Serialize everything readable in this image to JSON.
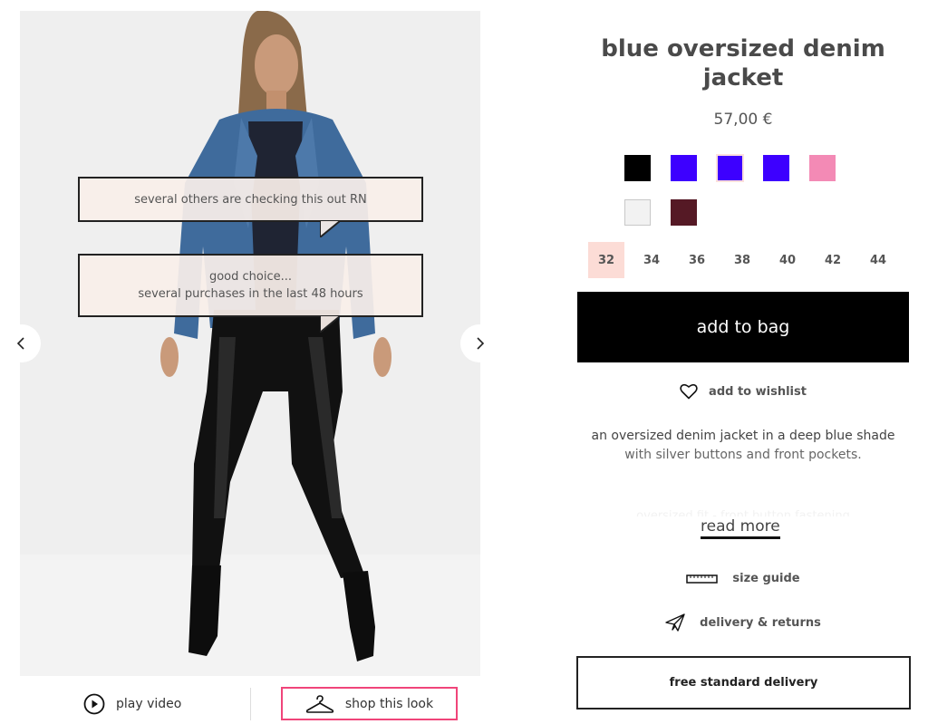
{
  "gallery": {
    "bubbles": [
      {
        "lines": [
          "several others are checking this out RN"
        ]
      },
      {
        "lines": [
          "good choice...",
          "several purchases in the last 48 hours"
        ]
      }
    ],
    "prev_icon": "chevron-left-icon",
    "next_icon": "chevron-right-icon"
  },
  "media": {
    "play_video_label": "play video",
    "shop_look_label": "shop this look",
    "shop_look_border_color": "#f0457a"
  },
  "product": {
    "title": "blue oversized denim jacket",
    "price": "57,00 €",
    "colors": [
      {
        "name": "black",
        "hex": "#000000",
        "selected": false
      },
      {
        "name": "blue",
        "hex": "#3d00ff",
        "selected": false
      },
      {
        "name": "blue",
        "hex": "#3d00ff",
        "selected": true
      },
      {
        "name": "blue",
        "hex": "#3d00ff",
        "selected": false
      },
      {
        "name": "pink",
        "hex": "#f38ab5",
        "selected": false
      },
      {
        "name": "white",
        "hex": "#f2f2f2",
        "selected": false
      },
      {
        "name": "burgundy",
        "hex": "#551925",
        "selected": false
      }
    ],
    "sizes": [
      {
        "label": "32",
        "selected": true
      },
      {
        "label": "34",
        "selected": false
      },
      {
        "label": "36",
        "selected": false
      },
      {
        "label": "38",
        "selected": false
      },
      {
        "label": "40",
        "selected": false
      },
      {
        "label": "42",
        "selected": false
      },
      {
        "label": "44",
        "selected": false
      }
    ],
    "add_to_bag_label": "add to bag",
    "wishlist_label": "add to wishlist",
    "description": {
      "line1": "an oversized denim jacket in a deep blue shade",
      "line2": "with silver buttons and front pockets.",
      "faded_line": "oversized fit - front button fastening"
    },
    "read_more_label": "read more",
    "size_guide_label": "size guide",
    "delivery_label": "delivery & returns",
    "free_delivery_label": "free standard delivery"
  }
}
